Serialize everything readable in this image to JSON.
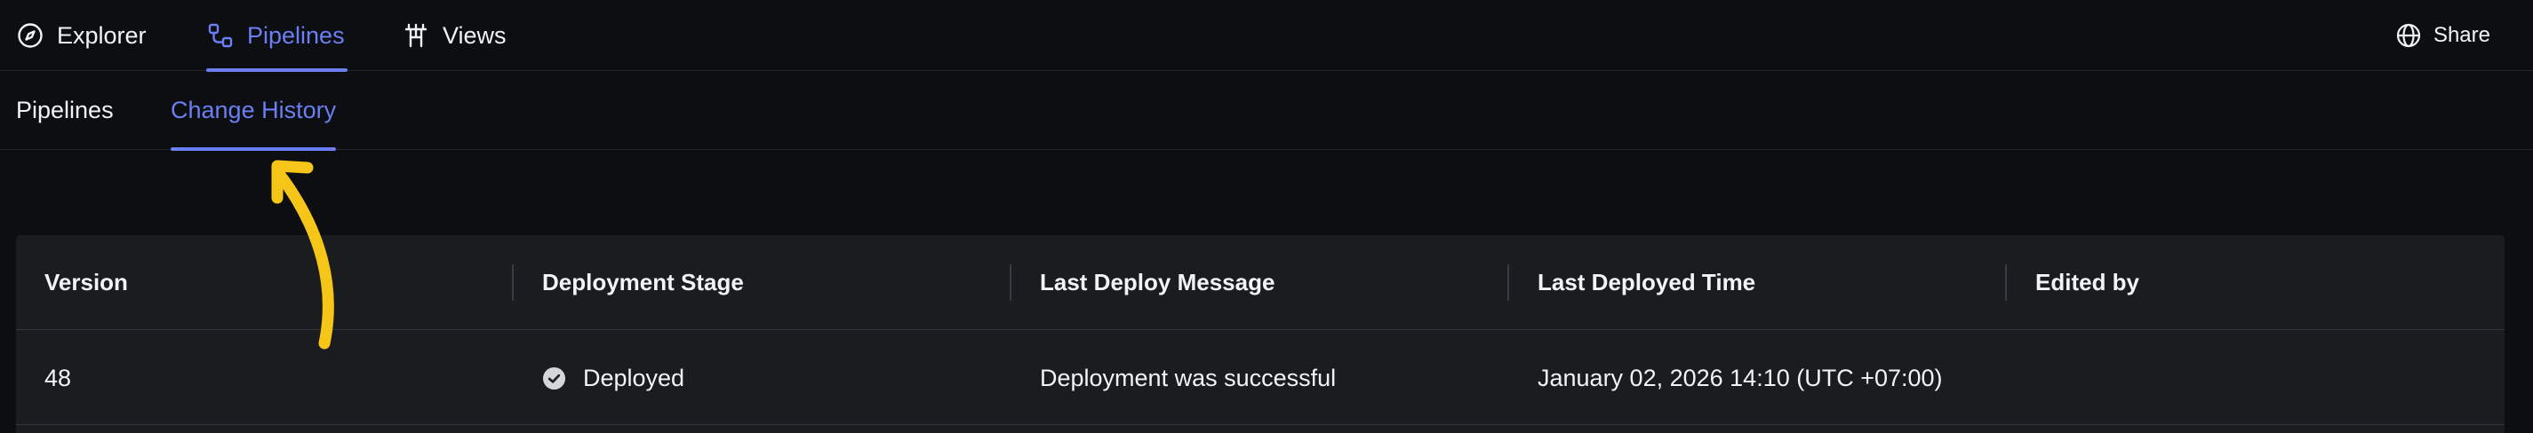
{
  "top_nav": {
    "items": [
      {
        "label": "Explorer",
        "icon": "compass-icon"
      },
      {
        "label": "Pipelines",
        "icon": "pipeline-icon",
        "active": true
      },
      {
        "label": "Views",
        "icon": "views-icon"
      }
    ],
    "share": {
      "label": "Share",
      "icon": "globe-icon"
    }
  },
  "sub_tabs": [
    {
      "label": "Pipelines"
    },
    {
      "label": "Change History",
      "active": true
    }
  ],
  "table": {
    "columns": [
      "Version",
      "Deployment Stage",
      "Last Deploy Message",
      "Last Deployed Time",
      "Edited by"
    ],
    "rows": [
      {
        "version": "48",
        "stage": "Deployed",
        "stage_icon": "check-circle-icon",
        "message": "Deployment was successful",
        "deployed_time": "January 02, 2026 14:10 (UTC +07:00)",
        "edited_by": ""
      }
    ]
  },
  "annotation": {
    "type": "arrow",
    "color": "#f5c518",
    "icon": "arrow-annotation"
  },
  "colors": {
    "background": "#0d0e11",
    "accent": "#6b7ff2",
    "table_bg": "#1b1c20",
    "text": "#f1f3f5"
  }
}
